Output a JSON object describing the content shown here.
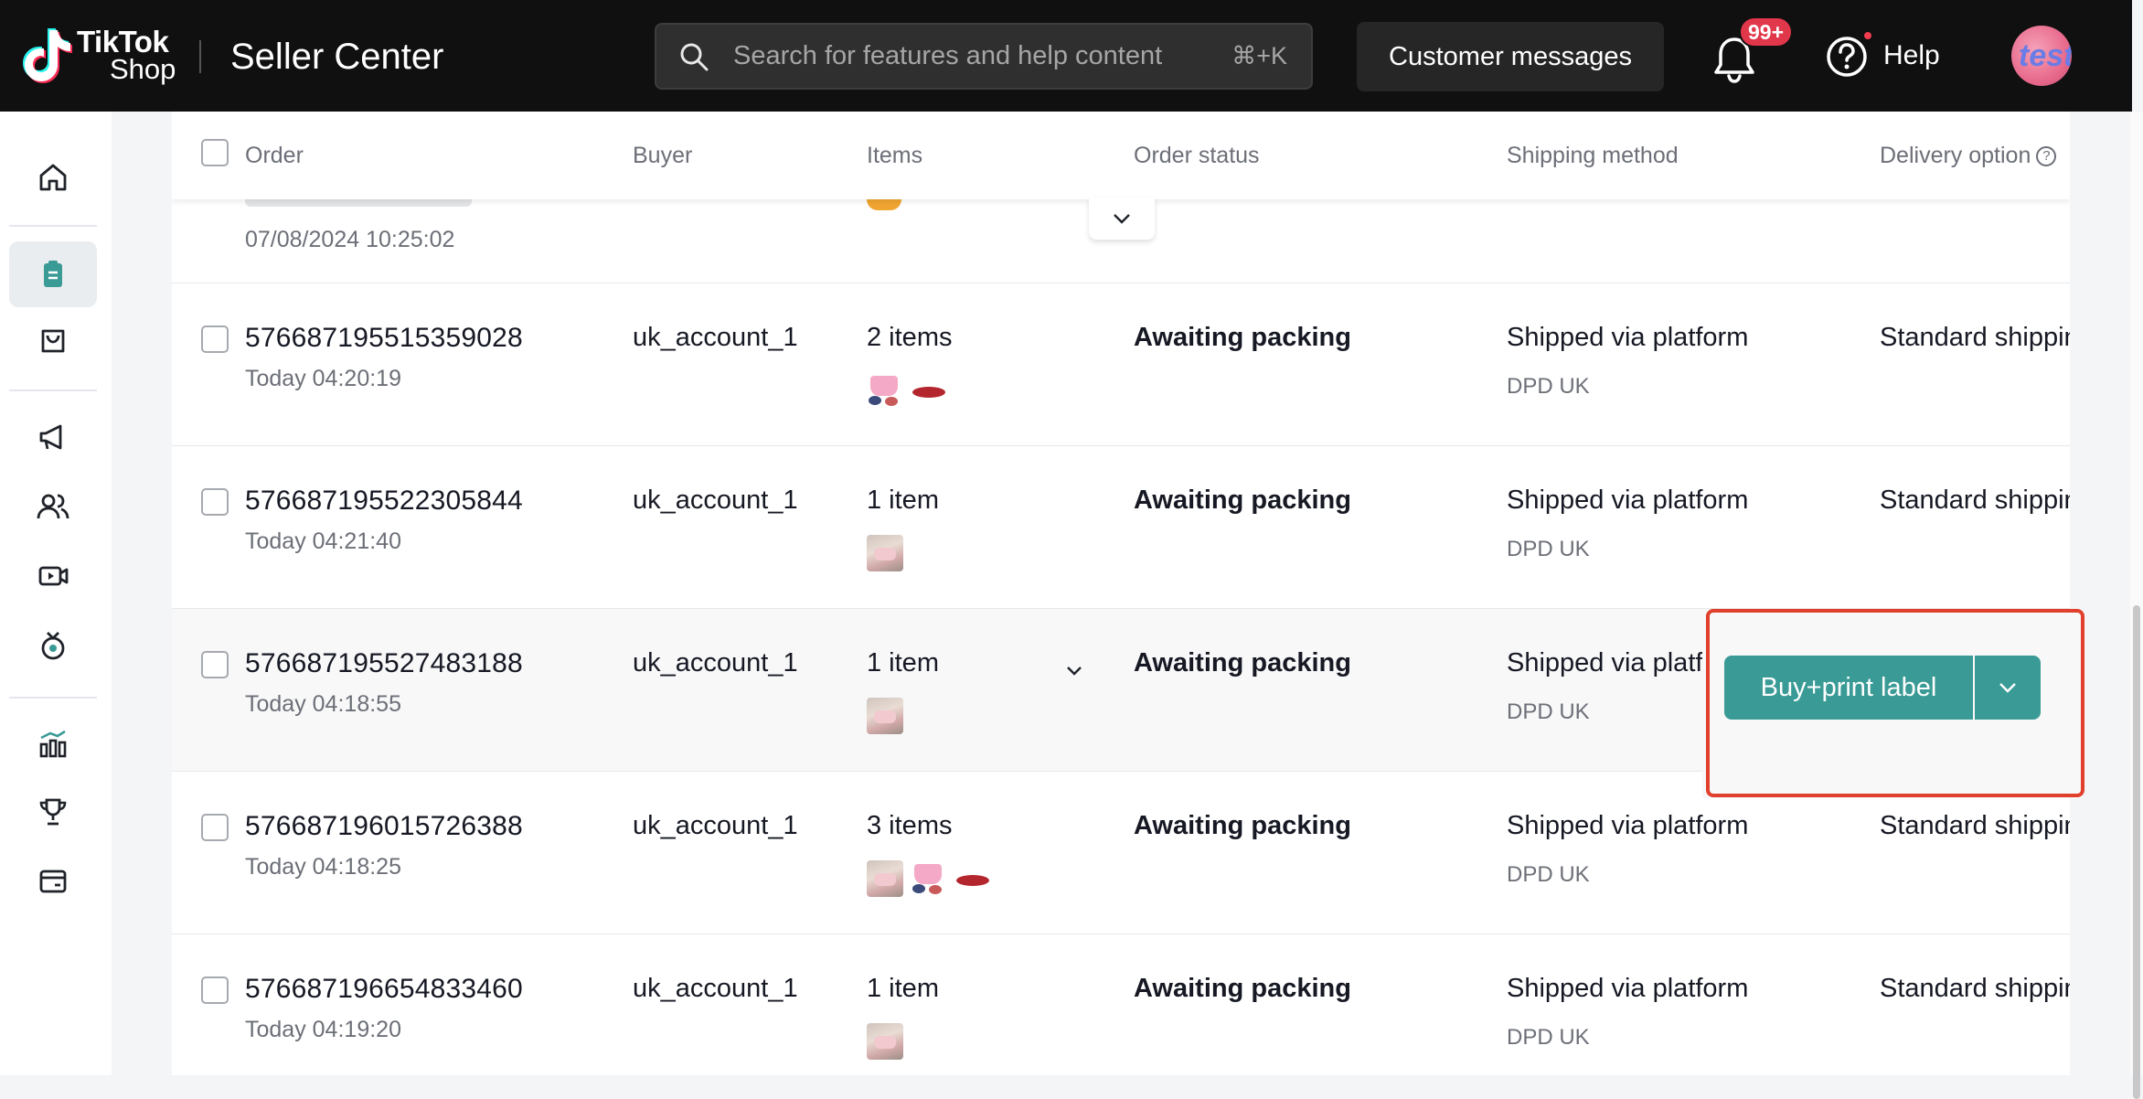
{
  "header": {
    "logo_line1": "TikTok",
    "logo_line2": "Shop",
    "app_title": "Seller Center",
    "search_placeholder": "Search for features and help content",
    "search_shortcut": "⌘+K",
    "customer_messages": "Customer messages",
    "notification_badge": "99+",
    "help_label": "Help",
    "avatar_text": "test"
  },
  "sidebar": {
    "items": [
      "home-icon",
      "orders-icon",
      "products-icon",
      "marketing-icon",
      "affiliate-icon",
      "live-video-icon",
      "growth-icon",
      "analytics-icon",
      "rewards-icon",
      "finance-icon"
    ],
    "active": "orders-icon"
  },
  "table": {
    "columns": {
      "order": "Order",
      "buyer": "Buyer",
      "items": "Items",
      "order_status": "Order status",
      "shipping_method": "Shipping method",
      "delivery_option": "Delivery option"
    },
    "partial_row": {
      "time": "07/08/2024 10:25:02"
    },
    "rows": [
      {
        "order_id": "576687195515359028",
        "time": "Today 04:20:19",
        "buyer": "uk_account_1",
        "items": "2 items",
        "thumbs": [
          "bag",
          "red"
        ],
        "status": "Awaiting packing",
        "shipping": "Shipped via platform",
        "carrier": "DPD UK",
        "delivery": "Standard shippin"
      },
      {
        "order_id": "576687195522305844",
        "time": "Today 04:21:40",
        "buyer": "uk_account_1",
        "items": "1 item",
        "thumbs": [
          "shoe"
        ],
        "status": "Awaiting packing",
        "shipping": "Shipped via platform",
        "carrier": "DPD UK",
        "delivery": "Standard shippin"
      },
      {
        "order_id": "576687195527483188",
        "time": "Today 04:18:55",
        "buyer": "uk_account_1",
        "items": "1 item",
        "thumbs": [
          "shoe"
        ],
        "status": "Awaiting packing",
        "shipping": "Shipped via platfo",
        "carrier": "DPD UK",
        "delivery": ""
      },
      {
        "order_id": "576687196015726388",
        "time": "Today 04:18:25",
        "buyer": "uk_account_1",
        "items": "3 items",
        "thumbs": [
          "shoe",
          "bag",
          "red"
        ],
        "status": "Awaiting packing",
        "shipping": "Shipped via platform",
        "carrier": "DPD UK",
        "delivery": "Standard shippin"
      },
      {
        "order_id": "576687196654833460",
        "time": "Today 04:19:20",
        "buyer": "uk_account_1",
        "items": "1 item",
        "thumbs": [
          "shoe"
        ],
        "status": "Awaiting packing",
        "shipping": "Shipped via platform",
        "carrier": "DPD UK",
        "delivery": "Standard shippin"
      }
    ]
  },
  "action": {
    "buy_print_label": "Buy+print label"
  },
  "colors": {
    "accent": "#3a9b96",
    "highlight": "#e0402c",
    "badge": "#e0374a"
  }
}
